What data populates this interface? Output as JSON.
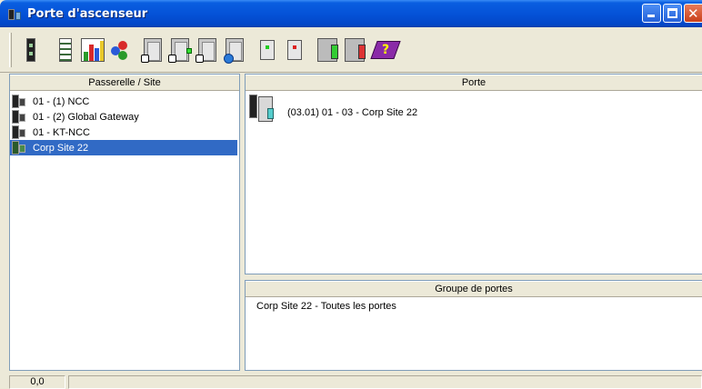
{
  "window": {
    "title": "Porte d'ascenseur",
    "controls": [
      "minimize",
      "maximize",
      "close"
    ]
  },
  "toolbar": {
    "buttons": [
      {
        "icon": "controller-panel-icon"
      },
      {
        "icon": "list-icon"
      },
      {
        "icon": "chart-icon"
      },
      {
        "icon": "people-icon"
      },
      {
        "icon": "door-lock-icon"
      },
      {
        "icon": "door-green-lock-icon"
      },
      {
        "icon": "door-lock-2-icon"
      },
      {
        "icon": "door-network-icon"
      },
      {
        "icon": "reader-green-icon"
      },
      {
        "icon": "reader-red-icon"
      },
      {
        "icon": "building-green-icon"
      },
      {
        "icon": "building-red-icon"
      },
      {
        "icon": "help-book-icon"
      }
    ]
  },
  "left_panel": {
    "header": "Passerelle / Site",
    "items": [
      {
        "label": "01 - (1) NCC",
        "selected": false
      },
      {
        "label": "01 - (2) Global Gateway",
        "selected": false
      },
      {
        "label": "01 - KT-NCC",
        "selected": false
      },
      {
        "label": "Corp Site 22",
        "selected": true
      }
    ]
  },
  "porte_panel": {
    "header": "Porte",
    "items": [
      {
        "label": "(03.01) 01 - 03 - Corp Site 22"
      }
    ]
  },
  "groupe_panel": {
    "header": "Groupe de portes",
    "items": [
      {
        "label": "Corp Site 22 - Toutes les portes"
      }
    ]
  },
  "statusbar": {
    "coord": "0,0",
    "message": ""
  },
  "colors": {
    "titlebar": "#0553d8",
    "selection": "#316ac5",
    "background": "#ece9d8"
  }
}
